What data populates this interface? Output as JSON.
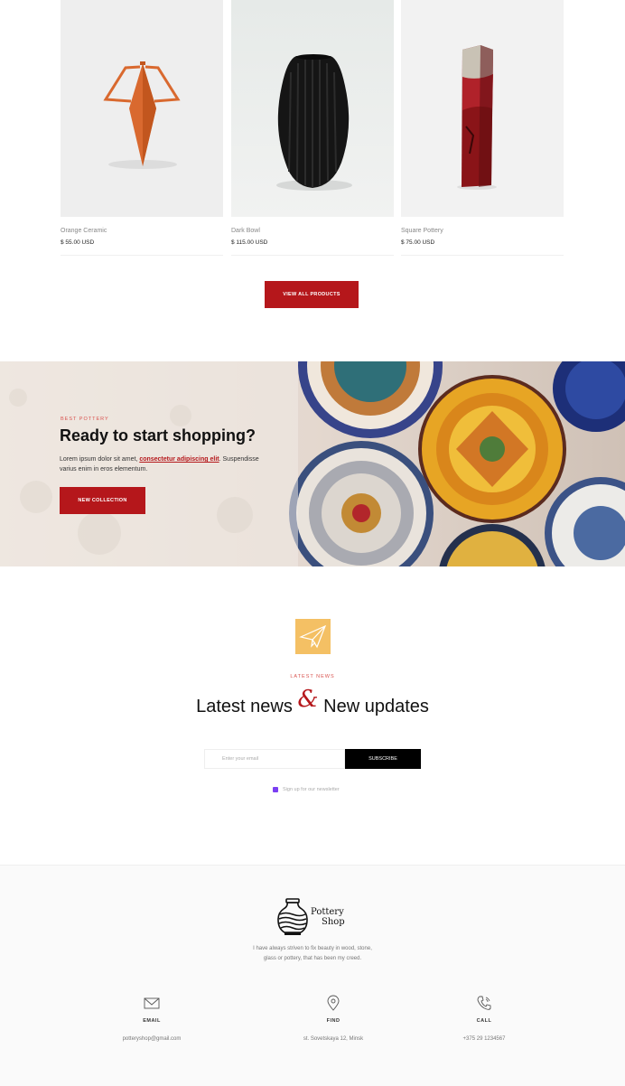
{
  "products": [
    {
      "name": "Orange Ceramic",
      "price": "$ 55.00 USD"
    },
    {
      "name": "Dark Bowl",
      "price": "$ 115.00 USD"
    },
    {
      "name": "Square Pottery",
      "price": "$ 75.00 USD"
    }
  ],
  "view_all_label": "VIEW ALL PRODUCTS",
  "banner": {
    "eyebrow": "BEST POTTERY",
    "title": "Ready to start shopping?",
    "desc_prefix": "Lorem ipsum dolor sit amet, ",
    "desc_link": "consectetur adipiscing elit",
    "desc_suffix": ". Suspendisse varius enim in eros elementum.",
    "button_label": "NEW COLLECTION"
  },
  "newsletter": {
    "eyebrow": "LATEST NEWS",
    "heading_part1": "Latest news ",
    "heading_amp": "&",
    "heading_part2": " New updates",
    "input_placeholder": "Enter your email",
    "subscribe_label": "SUBSCRIBE",
    "checkbox_label": "Sign up for our newsletter"
  },
  "footer": {
    "logo_line1": "Pottery",
    "logo_line2": "Shop",
    "tagline_line1": "I have always striven to fix beauty in wood, stone,",
    "tagline_line2": "glass or pottery, that has been my creed.",
    "columns": [
      {
        "title": "EMAIL",
        "value": "potteryshop@gmail.com",
        "icon": "envelope-icon"
      },
      {
        "title": "FIND",
        "value": "st. Sovetskaya 12, Minsk",
        "icon": "map-pin-icon"
      },
      {
        "title": "CALL",
        "value": "+375 29 1234567",
        "icon": "phone-icon"
      }
    ]
  },
  "colors": {
    "accent": "#b5171b",
    "newsletter_icon_bg": "#f4c064",
    "checkbox": "#7b3ff2"
  }
}
